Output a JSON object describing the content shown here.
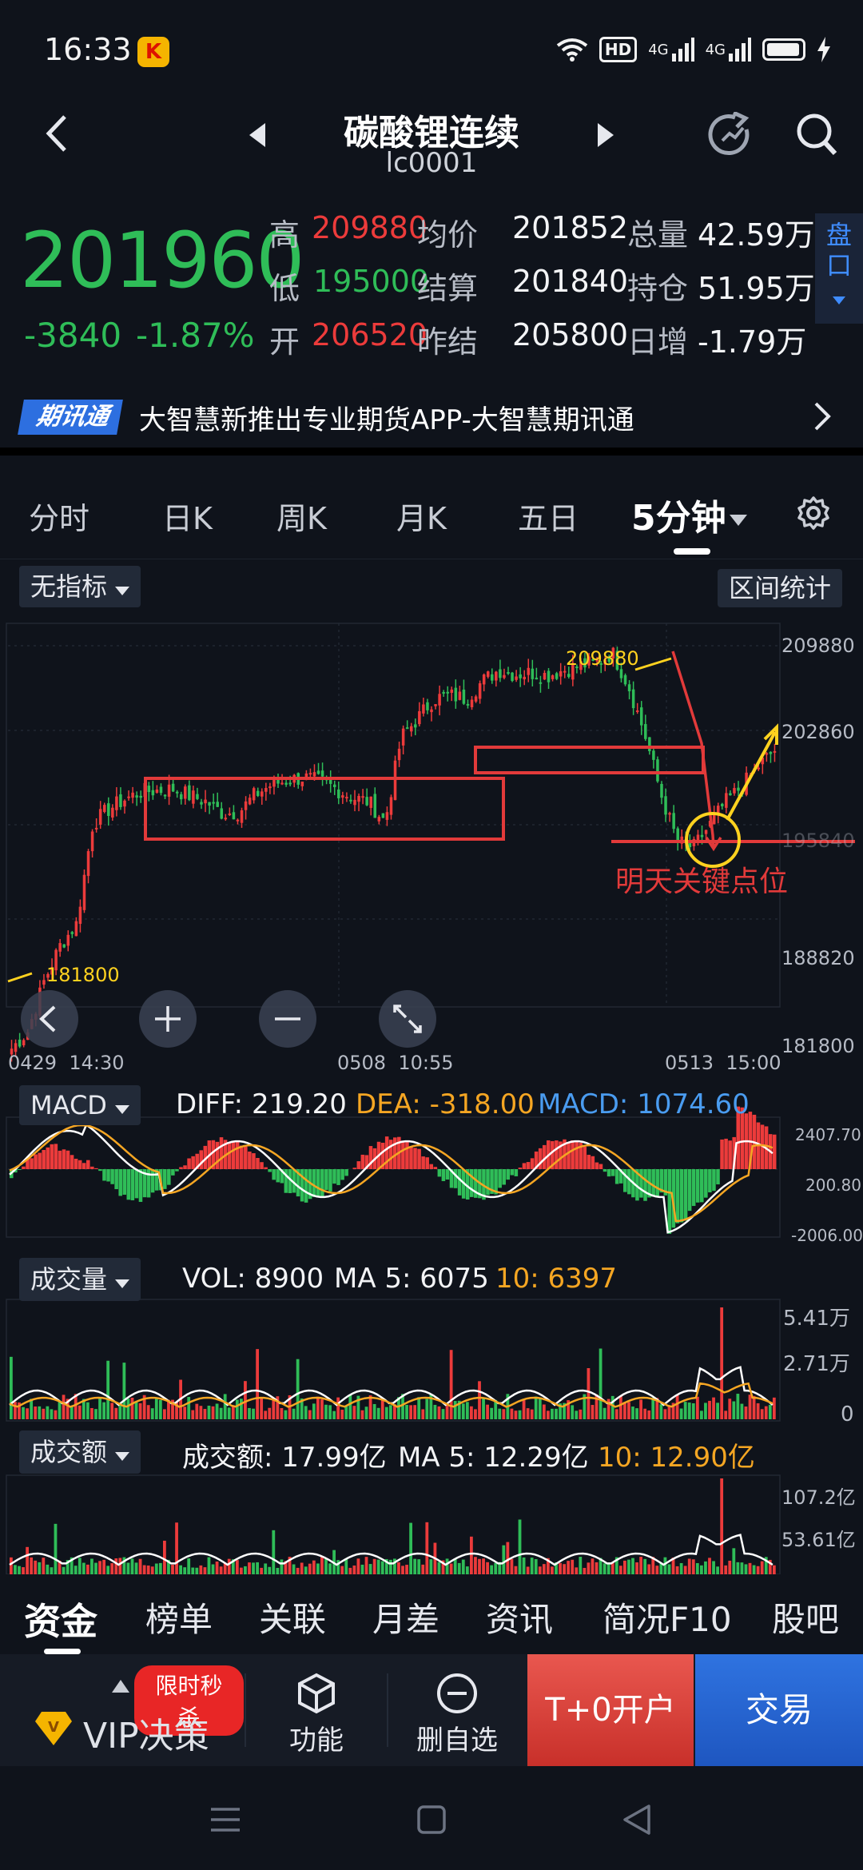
{
  "status": {
    "time": "16:33",
    "app_icon": "K",
    "hd": "HD",
    "net1": "4G",
    "net2": "4G"
  },
  "header": {
    "title": "碳酸锂连续",
    "code": "lc0001"
  },
  "quote": {
    "price": "201960",
    "change": "-3840",
    "change_pct": "-1.87%",
    "high_label": "高",
    "high": "209880",
    "avg_label": "均价",
    "avg": "201852",
    "volume_label": "总量",
    "volume": "42.59万",
    "low_label": "低",
    "low": "195000",
    "settle_label": "结算",
    "settle": "201840",
    "oi_label": "持仓",
    "oi": "51.95万",
    "open_label": "开",
    "open": "206520",
    "prev_settle_label": "昨结",
    "prev_settle": "205800",
    "daily_inc_label": "日增",
    "daily_inc": "-1.79万",
    "pankou": "盘口"
  },
  "news": {
    "badge": "期讯通",
    "text": "大智慧新推出专业期货APP-大智慧期讯通"
  },
  "tabs": [
    "分时",
    "日K",
    "周K",
    "月K",
    "五日",
    "5分钟"
  ],
  "chart_controls": {
    "indicator": "无指标",
    "interval_stats": "区间统计"
  },
  "chart_data": {
    "type": "candlestick",
    "y_ticks": [
      "209880",
      "202860",
      "195840",
      "188820",
      "181800"
    ],
    "x_labels": [
      "0429  14:30",
      "0508  10:55",
      "0513  15:00"
    ],
    "annotations": {
      "high_label": "209880",
      "low_label": "181800",
      "note": "明天关键点位"
    },
    "price_path": [
      181800,
      183000,
      186500,
      189000,
      190500,
      197500,
      198500,
      199200,
      199700,
      199800,
      199900,
      199400,
      199000,
      198200,
      198300,
      199500,
      200200,
      200500,
      200700,
      200400,
      199900,
      199300,
      199000,
      197600,
      203500,
      204800,
      206200,
      206400,
      206200,
      207400,
      208200,
      207900,
      208000,
      207800,
      208200,
      208500,
      208700,
      209400,
      207100,
      203700,
      199500,
      196200,
      195800,
      197400,
      199000,
      200100,
      201500,
      202600
    ],
    "macd": {
      "diff": "219.20",
      "dea": "-318.00",
      "macd": "1074.60",
      "ticks": [
        "2407.70",
        "200.80",
        "-2006.00"
      ]
    },
    "volume": {
      "vol": "8900",
      "ma5": "6075",
      "ma10": "6397",
      "ticks": [
        "5.41万",
        "2.71万",
        "0"
      ]
    },
    "amount": {
      "amt": "17.99亿",
      "ma5": "12.29亿",
      "ma10": "12.90亿",
      "ticks": [
        "107.2亿",
        "53.61亿"
      ]
    }
  },
  "macd_label": "MACD",
  "vol_label": "成交量",
  "amt_label": "成交额",
  "macd_stats": {
    "diff_label": "DIFF: ",
    "dea_label": "DEA: ",
    "macd_label": "MACD: "
  },
  "vol_stats": {
    "vol_label": "VOL: ",
    "ma5_label": "MA 5: ",
    "ma10_label": "10: "
  },
  "amt_stats": {
    "amt_label": "成交额: ",
    "ma5_label": "MA 5: ",
    "ma10_label": "10: "
  },
  "bottom_tabs": [
    "资金",
    "榜单",
    "关联",
    "月差",
    "资讯",
    "简况F10",
    "股吧"
  ],
  "actions": {
    "vip": "VIP决策",
    "flash": "限时秒杀",
    "func": "功能",
    "delete": "删自选",
    "tplus": "T+0开户",
    "trade": "交易"
  },
  "colors": {
    "up": "#ec3b3b",
    "down": "#2fbd58",
    "accent": "#3f8cff",
    "annotation_yellow": "#ffd21f"
  }
}
